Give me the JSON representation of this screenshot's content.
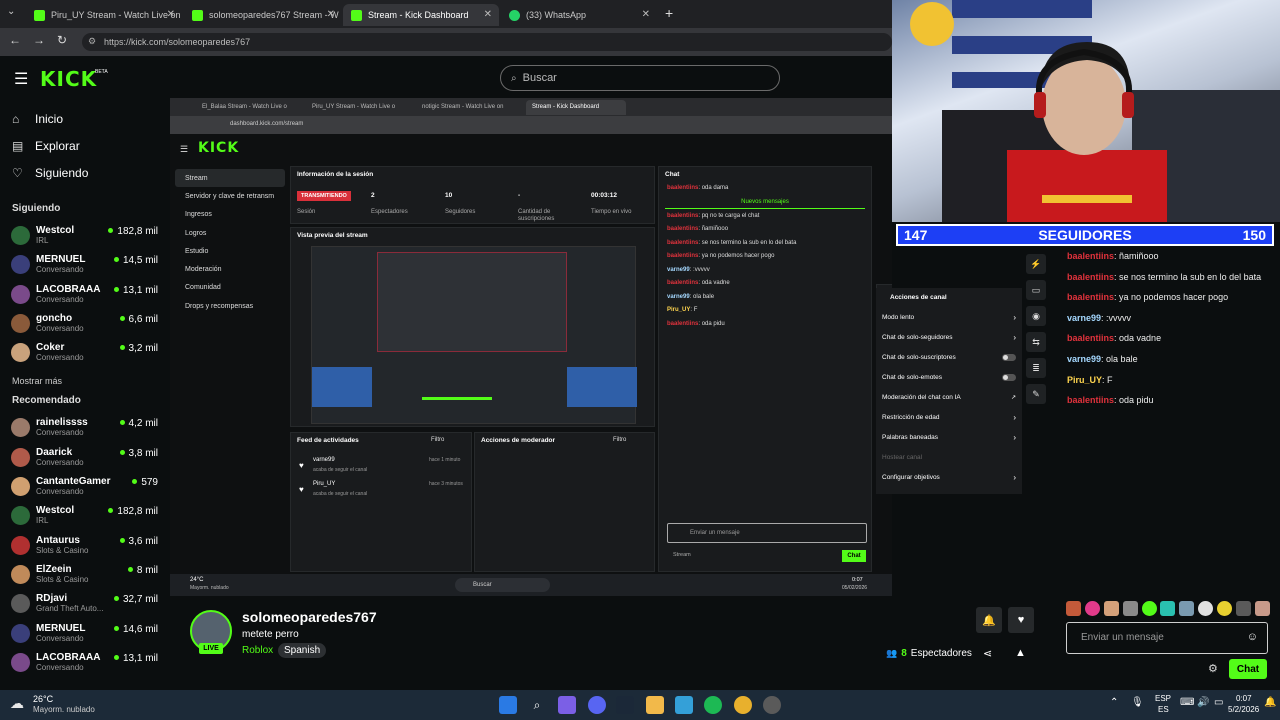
{
  "browser": {
    "tabs": [
      {
        "label": "Piru_UY Stream - Watch Live on",
        "icon": "kick-icon"
      },
      {
        "label": "solomeoparedes767 Stream - W",
        "icon": "kick-icon"
      },
      {
        "label": "Stream - Kick Dashboard",
        "icon": "kick-icon"
      },
      {
        "label": "(33) WhatsApp",
        "icon": "whatsapp-icon"
      }
    ],
    "url": "https://kick.com/solomeoparedes767"
  },
  "header": {
    "logo": "KICK",
    "logo_badge": "BETA",
    "search_placeholder": "Buscar"
  },
  "sidebar": {
    "nav": [
      {
        "label": "Inicio",
        "icon": "home-icon"
      },
      {
        "label": "Explorar",
        "icon": "compass-icon"
      },
      {
        "label": "Siguiendo",
        "icon": "heart-icon"
      }
    ],
    "following_title": "Siguiendo",
    "following": [
      {
        "name": "Westcol",
        "category": "IRL",
        "viewers": "182,8 mil",
        "color": "#2c6a3a"
      },
      {
        "name": "MERNUEL",
        "category": "Conversando",
        "viewers": "14,5 mil",
        "color": "#3a3f7a"
      },
      {
        "name": "LACOBRAAA",
        "category": "Conversando",
        "viewers": "13,1 mil",
        "color": "#7a4a8a"
      },
      {
        "name": "goncho",
        "category": "Conversando",
        "viewers": "6,6 mil",
        "color": "#8a5a3a"
      },
      {
        "name": "Coker",
        "category": "Conversando",
        "viewers": "3,2 mil",
        "color": "#c9a27c"
      }
    ],
    "show_more": "Mostrar más",
    "recommended_title": "Recomendado",
    "recommended": [
      {
        "name": "rainelissss",
        "category": "Conversando",
        "viewers": "4,2 mil",
        "color": "#9a7a6a"
      },
      {
        "name": "Daarick",
        "category": "Conversando",
        "viewers": "3,8 mil",
        "color": "#b05a4a"
      },
      {
        "name": "CantanteGamer",
        "category": "Conversando",
        "viewers": "579",
        "color": "#d0a070"
      },
      {
        "name": "Westcol",
        "category": "IRL",
        "viewers": "182,8 mil",
        "color": "#2c6a3a"
      },
      {
        "name": "Antaurus",
        "category": "Slots & Casino",
        "viewers": "3,6 mil",
        "color": "#b03030"
      },
      {
        "name": "ElZeein",
        "category": "Slots & Casino",
        "viewers": "8 mil",
        "color": "#c08a5a"
      },
      {
        "name": "RDjavi",
        "category": "Grand Theft Auto...",
        "viewers": "32,7 mil",
        "color": "#5a5a5a"
      },
      {
        "name": "MERNUEL",
        "category": "Conversando",
        "viewers": "14,6 mil",
        "color": "#3a3f7a"
      },
      {
        "name": "LACOBRAAA",
        "category": "Conversando",
        "viewers": "13,1 mil",
        "color": "#7a4a8a"
      }
    ]
  },
  "inner": {
    "tabs": [
      "El_Balaa Stream - Watch Live o",
      "Piru_UY Stream - Watch Live o",
      "notigic Stream - Watch Live on",
      "Stream - Kick Dashboard"
    ],
    "url": "dashboard.kick.com/stream",
    "nav": [
      "Stream",
      "Servidor y clave de retransm",
      "Ingresos",
      "Logros",
      "Estudio",
      "Moderación",
      "Comunidad",
      "Drops y recompensas"
    ],
    "session_title": "Información de la sesión",
    "live_badge": "TRANSMITIENDO",
    "session_label": "Sesión",
    "stats": [
      {
        "value": "2",
        "label": "Espectadores"
      },
      {
        "value": "10",
        "label": "Seguidores"
      },
      {
        "value": "-",
        "label": "Cantidad de suscripciones"
      },
      {
        "value": "00:03:12",
        "label": "Tiempo en vivo"
      }
    ],
    "preview_title": "Vista previa del stream",
    "feed_title": "Feed de actividades",
    "feed_filter": "Filtro",
    "feed": [
      {
        "user": "varne99",
        "action": "acaba de seguir el canal",
        "time": "hace 1 minuto"
      },
      {
        "user": "Piru_UY",
        "action": "acaba de seguir el canal",
        "time": "hace 3 minutos"
      }
    ],
    "mod_title": "Acciones de moderador",
    "mod_filter": "Filtro",
    "chat_title": "Chat",
    "new_messages": "Nuevos mensajes",
    "chat": [
      {
        "user": "baalentiins",
        "msg": "oda dama",
        "color": "red"
      },
      {
        "user": "baalentiins",
        "msg": "pq no te carga el chat",
        "color": "red"
      },
      {
        "user": "baalentiins",
        "msg": "ñamiñooo",
        "color": "red"
      },
      {
        "user": "baalentiins",
        "msg": "se nos termino la sub en lo del bata",
        "color": "red"
      },
      {
        "user": "baalentiins",
        "msg": "ya no podemos hacer pogo",
        "color": "red"
      },
      {
        "user": "varne99",
        "msg": ":vvvvv",
        "color": "blu"
      },
      {
        "user": "baalentiins",
        "msg": "oda vadne",
        "color": "red"
      },
      {
        "user": "varne99",
        "msg": "ola bale",
        "color": "blu"
      },
      {
        "user": "Piru_UY",
        "msg": "F",
        "color": "yel"
      },
      {
        "user": "baalentiins",
        "msg": "oda pidu",
        "color": "red"
      }
    ],
    "chat_placeholder": "Enviar un mensaje",
    "chat_tab": "Stream",
    "chat_button": "Chat",
    "channel_actions_title": "Acciones de canal",
    "channel_actions": [
      "Modo lento",
      "Chat de solo-seguidores",
      "Chat de solo-suscriptores",
      "Chat de solo-emotes",
      "Moderación del chat con IA",
      "Restricción de edad",
      "Palabras baneadas",
      "Hostear canal",
      "Configurar objetivos"
    ],
    "taskbar_weather": "24°C",
    "taskbar_weather_desc": "Mayorm. nublado",
    "taskbar_search": "Buscar",
    "taskbar_time": "0:07",
    "taskbar_date": "05/02/2026"
  },
  "overlay": {
    "left": "147",
    "label": "SEGUIDORES",
    "right": "150"
  },
  "right_chat": {
    "messages": [
      {
        "user": "baalentiins",
        "msg": "ñamiñooo",
        "color": "red"
      },
      {
        "user": "baalentiins",
        "msg": "se nos termino la sub en lo del bata",
        "color": "red"
      },
      {
        "user": "baalentiins",
        "msg": "ya no podemos hacer pogo",
        "color": "red"
      },
      {
        "user": "varne99",
        "msg": ":vvvvv",
        "color": "blu"
      },
      {
        "user": "baalentiins",
        "msg": "oda vadne",
        "color": "red"
      },
      {
        "user": "varne99",
        "msg": "ola bale",
        "color": "blu"
      },
      {
        "user": "Piru_UY",
        "msg": "F",
        "color": "yel"
      },
      {
        "user": "baalentiins",
        "msg": "oda pidu",
        "color": "red"
      }
    ],
    "placeholder": "Enviar un mensaje",
    "button": "Chat"
  },
  "stream": {
    "username": "solomeoparedes767",
    "title": "metete perro",
    "category": "Roblox",
    "language": "Spanish",
    "live": "LIVE",
    "viewers_count": "8",
    "viewers_label": "Espectadores"
  },
  "taskbar": {
    "temp": "26°C",
    "weather": "Mayorm. nublado",
    "lang1": "ESP",
    "lang2": "ES",
    "time": "0:07",
    "date": "5/2/2026"
  },
  "colors": {
    "kick_green": "#53fc18",
    "overlay_blue": "#1d3ff5",
    "chat_red": "#e0323c"
  }
}
